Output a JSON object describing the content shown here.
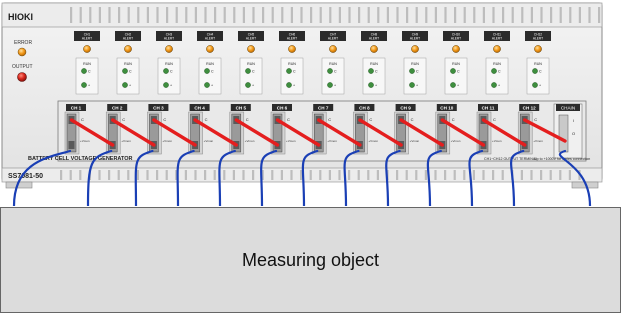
{
  "brand": "HIOKI",
  "status_labels": {
    "error": "ERROR",
    "output": "OUTPUT"
  },
  "alert_label": "ALERT",
  "run_label": "RUN",
  "module_ids": [
    "CH1",
    "CH2",
    "CH3",
    "CH4",
    "CH5",
    "CH6",
    "CH7",
    "CH8",
    "CH9",
    "CH10",
    "CH11",
    "CH12"
  ],
  "channels": [
    "CH 1",
    "CH 2",
    "CH 3",
    "CH 4",
    "CH 5",
    "CH 6",
    "CH 7",
    "CH 8",
    "CH 9",
    "CH 10",
    "CH 11",
    "CH 12"
  ],
  "chain_label": "CHAIN",
  "term_letters": {
    "top": "C",
    "mid": "I",
    "bot": "O"
  },
  "vmon_label": "+Vmon",
  "panel_caption": "BATTERY CELL VOLTAGE GENERATOR",
  "model": "SS7081-50",
  "warning_left": "CH1~CH12 OUTPUT TERMINAL",
  "warning_right": "Up to +1000V for series connection",
  "measuring_object": "Measuring object",
  "colors": {
    "link": "#e41e1e",
    "cable": "#1a3fb5",
    "led_on": "#f39a1a",
    "led_red": "#d8261c",
    "led_green": "#3e8e3e"
  }
}
